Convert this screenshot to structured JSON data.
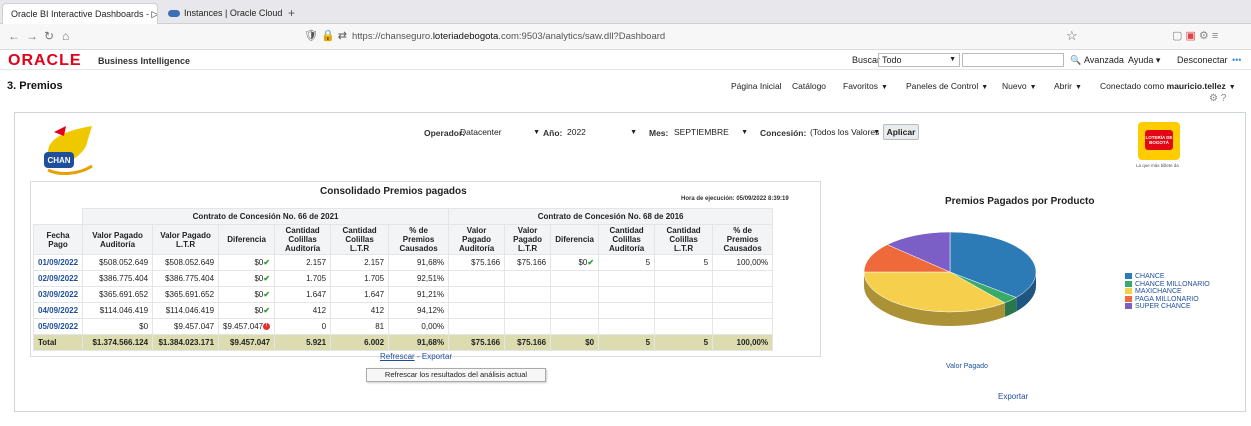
{
  "browser": {
    "tabs": [
      {
        "label": "Oracle BI Interactive Dashboards - ▷"
      },
      {
        "label": "Instances | Oracle Cloud Infrastr"
      }
    ],
    "url_prefix": "https://chanseguro.",
    "url_domain": "loteriadebogota",
    "url_suffix": ".com:9503/analytics/saw.dll?Dashboard"
  },
  "header": {
    "logo": "ORACLE",
    "product": "Business Intelligence",
    "buscar_label": "Buscar",
    "buscar_value": "Todo",
    "avanzada": "Avanzada",
    "ayuda": "Ayuda",
    "desconectar": "Desconectar"
  },
  "page": {
    "title": "3. Premios",
    "menu": {
      "inicio": "Página Inicial",
      "catalogo": "Catálogo",
      "favoritos": "Favoritos",
      "paneles": "Paneles de Control",
      "nuevo": "Nuevo",
      "abrir": "Abrir",
      "conectado": "Conectado como",
      "usuario": "mauricio.tellez"
    }
  },
  "prompts": {
    "operador_label": "Operador:",
    "operador_value": "Datacenter",
    "anio_label": "Año:",
    "anio_value": "2022",
    "mes_label": "Mes:",
    "mes_value": "SEPTIEMBRE",
    "concesion_label": "Concesión:",
    "concesion_value": "(Todos los Valores",
    "apply": "Aplicar"
  },
  "logos": {
    "chance_text": "CHAN",
    "loteria_text": "LOTERÍA DE BOGOTÁ",
    "loteria_tag": "La que más billete da"
  },
  "table": {
    "title": "Consolidado Premios pagados",
    "exec_time": "Hora de ejecución: 05/09/2022 8:39:19",
    "group1": "Contrato de Concesión No. 66 de 2021",
    "group2": "Contrato de Concesión No. 68 de 2016",
    "headers": [
      "Fecha Pago",
      "Valor Pagado Auditoría",
      "Valor Pagado L.T.R",
      "Diferencia",
      "Cantidad Colillas Auditoría",
      "Cantidad Colillas L.T.R",
      "% de Premios Causados",
      "Valor Pagado Auditoría",
      "Valor Pagado L.T.R",
      "Diferencia",
      "Cantidad Colillas Auditoría",
      "Cantidad Colillas L.T.R",
      "% de Premios Causados"
    ],
    "rows": [
      [
        "01/09/2022",
        "$508.052.649",
        "$508.052.649",
        "$0",
        "2.157",
        "2.157",
        "91,68%",
        "$75.166",
        "$75.166",
        "$0",
        "5",
        "5",
        "100,00%"
      ],
      [
        "02/09/2022",
        "$386.775.404",
        "$386.775.404",
        "$0",
        "1.705",
        "1.705",
        "92,51%",
        "",
        "",
        "",
        "",
        "",
        ""
      ],
      [
        "03/09/2022",
        "$365.691.652",
        "$365.691.652",
        "$0",
        "1.647",
        "1.647",
        "91,21%",
        "",
        "",
        "",
        "",
        "",
        ""
      ],
      [
        "04/09/2022",
        "$114.046.419",
        "$114.046.419",
        "$0",
        "412",
        "412",
        "94,12%",
        "",
        "",
        "",
        "",
        "",
        ""
      ],
      [
        "05/09/2022",
        "$0",
        "$9.457.047",
        "$9.457.047",
        "0",
        "81",
        "0,00%",
        "",
        "",
        "",
        "",
        "",
        ""
      ]
    ],
    "total": [
      "Total",
      "$1.374.566.124",
      "$1.384.023.171",
      "$9.457.047",
      "5.921",
      "6.002",
      "91,68%",
      "$75.166",
      "$75.166",
      "$0",
      "5",
      "5",
      "100,00%"
    ],
    "refresh": "Refrescar",
    "export": "- Exportar",
    "tooltip": "Refrescar los resultados del análisis actual"
  },
  "pie": {
    "title": "Premios Pagados por Producto",
    "note": "Valor Pagado",
    "export": "Exportar",
    "legend": [
      {
        "name": "CHANCE",
        "color": "#2c7bb6"
      },
      {
        "name": "CHANCE MILLONARIO",
        "color": "#3aaa6a"
      },
      {
        "name": "MAXICHANCE",
        "color": "#f6d04d"
      },
      {
        "name": "PAGA MILLONARIO",
        "color": "#ee6a3a"
      },
      {
        "name": "SUPER CHANCE",
        "color": "#7b5fc7"
      }
    ]
  },
  "chart_data": {
    "type": "pie",
    "title": "Premios Pagados por Producto",
    "categories": [
      "CHANCE",
      "CHANCE MILLONARIO",
      "MAXICHANCE",
      "PAGA MILLONARIO",
      "SUPER CHANCE"
    ],
    "values": [
      36,
      3,
      36,
      12,
      13
    ],
    "legend_position": "right"
  }
}
